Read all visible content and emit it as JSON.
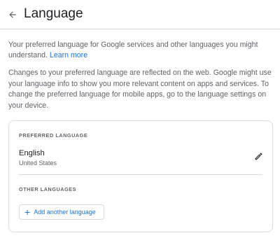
{
  "header": {
    "back_icon": "arrow-left-icon",
    "title": "Language"
  },
  "intro": {
    "text": "Your preferred language for Google services and other languages you might understand.",
    "learn_more": "Learn more"
  },
  "info": {
    "text": "Changes to your preferred language are reflected on the web. Google might use your language info to show you more relevant content on apps and services. To change the preferred language for mobile apps, go to the language settings on your device."
  },
  "preferred": {
    "label": "PREFERRED LANGUAGE",
    "language": "English",
    "region": "United States",
    "edit_icon": "pencil-icon"
  },
  "other": {
    "label": "OTHER LANGUAGES",
    "add_icon": "plus-icon",
    "add_label": "Add another language"
  },
  "colors": {
    "accent": "#1a73e8",
    "border": "#dadce0",
    "text": "#202124",
    "muted": "#5f6368"
  }
}
